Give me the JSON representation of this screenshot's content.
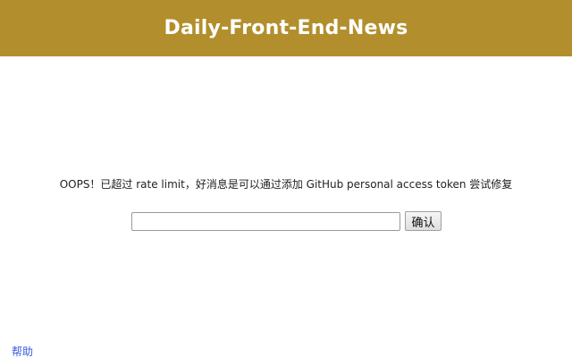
{
  "header": {
    "title": "Daily-Front-End-News"
  },
  "main": {
    "message": "OOPS！已超过 rate limit，好消息是可以通过添加 GitHub personal access token 尝试修复",
    "token_input": {
      "value": "",
      "placeholder": ""
    },
    "confirm_label": "确认"
  },
  "footer": {
    "help_label": "帮助"
  },
  "colors": {
    "header_bg": "#b28f2c",
    "header_text": "#ffffff",
    "link": "#3b5bdb"
  }
}
